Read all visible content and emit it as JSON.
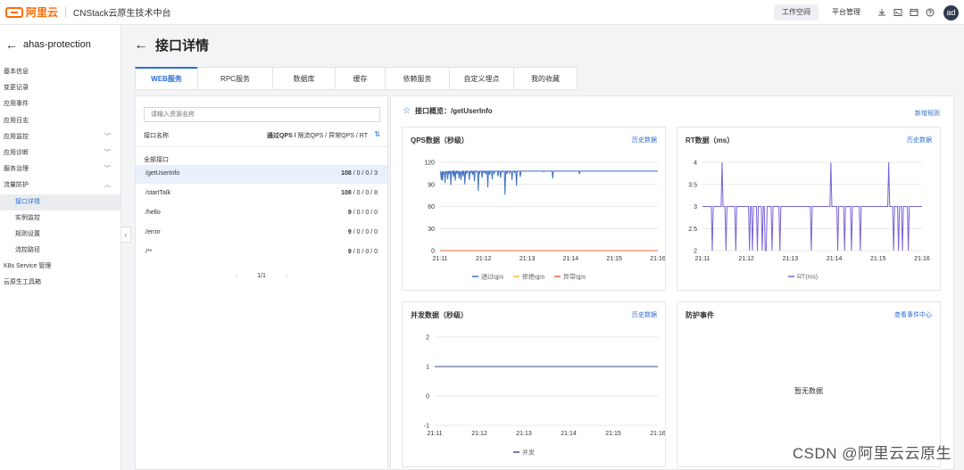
{
  "topbar": {
    "logo_text": "阿里云",
    "product_name": "CNStack云原生技术中台",
    "tabs": [
      "工作空间",
      "平台管理"
    ],
    "avatar": "ad"
  },
  "sidebar": {
    "back_icon": "arrow-left-icon",
    "app_name": "ahas-protection",
    "items": [
      {
        "label": "基本信息",
        "level": 1
      },
      {
        "label": "变更记录",
        "level": 1
      },
      {
        "label": "应用事件",
        "level": 1
      },
      {
        "label": "应用日志",
        "level": 1
      },
      {
        "label": "应用监控",
        "level": 1,
        "chevron": "down"
      },
      {
        "label": "应用诊断",
        "level": 1,
        "chevron": "down"
      },
      {
        "label": "服务治理",
        "level": 1,
        "chevron": "down"
      },
      {
        "label": "流量防护",
        "level": 1,
        "chevron": "up"
      },
      {
        "label": "接口详情",
        "level": 2,
        "active": true
      },
      {
        "label": "实例监控",
        "level": 2
      },
      {
        "label": "规则设置",
        "level": 2
      },
      {
        "label": "流控路径",
        "level": 2
      },
      {
        "label": "K8s Service 管理",
        "level": 1
      },
      {
        "label": "云原生工具箱",
        "level": 1
      }
    ]
  },
  "page": {
    "title": "接口详情",
    "tabs": [
      "WEB服务",
      "RPC服务",
      "数据库",
      "缓存",
      "依赖服务",
      "自定义埋点",
      "我的收藏"
    ],
    "active_tab": 0
  },
  "api_list": {
    "search_placeholder": "请输入资源名称",
    "header_name": "接口名称",
    "header_cols_bold": "通过QPS /",
    "header_cols_rest": " 限流QPS / 异常QPS / RT",
    "all_label": "全部接口",
    "rows": [
      {
        "name": "/getUserInfo",
        "pass": "108",
        "rest": " / 0 / 0 / 3",
        "selected": true
      },
      {
        "name": "/startTalk",
        "pass": "108",
        "rest": " / 0 / 0 / 8"
      },
      {
        "name": "/hello",
        "pass": "9",
        "rest": " / 0 / 0 / 0"
      },
      {
        "name": "/error",
        "pass": "9",
        "rest": " / 0 / 0 / 0"
      },
      {
        "name": "/**",
        "pass": "9",
        "rest": " / 0 / 0 / 0"
      }
    ],
    "pager": "1/1"
  },
  "overview": {
    "title": "接口概览：/getUserInfo",
    "new_rule": "新增规则",
    "history_link": "历史数据",
    "events_title": "防护事件",
    "events_link": "查看事件中心",
    "events_empty": "暂无数据"
  },
  "chart_data": [
    {
      "type": "line",
      "title": "QPS数据（秒级）",
      "x": [
        "21:11",
        "21:12",
        "21:13",
        "21:14",
        "21:15",
        "21:16"
      ],
      "ylim": [
        0,
        120
      ],
      "yticks": [
        0,
        30,
        60,
        90,
        120
      ],
      "series": [
        {
          "name": "通过qps",
          "color": "#3b6ec2",
          "values": [
            108,
            106,
            96,
            108,
            95,
            108,
            104,
            107,
            92,
            108,
            106,
            108,
            97,
            108,
            105,
            108,
            108,
            89,
            108,
            106,
            108,
            100,
            108,
            107,
            95,
            108,
            108,
            104,
            108,
            108,
            98,
            108,
            106,
            96,
            108,
            108,
            101,
            108,
            107,
            90,
            108,
            108,
            105,
            108,
            108,
            108,
            96,
            108,
            106,
            108,
            108,
            103,
            108,
            108,
            94,
            108,
            108,
            107,
            108,
            108,
            81,
            108,
            105,
            108,
            108,
            108,
            99,
            108,
            108,
            106,
            108,
            108,
            104,
            108,
            108,
            86,
            108,
            108,
            103,
            108,
            108,
            108,
            97,
            108,
            108,
            105,
            108,
            108,
            108,
            108,
            108,
            101,
            108,
            108,
            108,
            99,
            108,
            108,
            107,
            108,
            108,
            108,
            76,
            108,
            108,
            104,
            108,
            108,
            108,
            105,
            108,
            108,
            108,
            96,
            108,
            108,
            108,
            106,
            108,
            108,
            88,
            108,
            108,
            108,
            108,
            108,
            100,
            108,
            108,
            108,
            108,
            108,
            108,
            108,
            108,
            108,
            108,
            108,
            108,
            108,
            108,
            108,
            108,
            108,
            108,
            108,
            108,
            108,
            108,
            108,
            108,
            108,
            108,
            108,
            108,
            108,
            108,
            108,
            108,
            108,
            108,
            108,
            108,
            107,
            108,
            108,
            108,
            108,
            108,
            108,
            108,
            108,
            108,
            108,
            108,
            108,
            108,
            98,
            108,
            108,
            108,
            108,
            108,
            108,
            108,
            108,
            108,
            108,
            108,
            108,
            108,
            108,
            108,
            108,
            108,
            108,
            108,
            108,
            108,
            108,
            108,
            108,
            108,
            108,
            108,
            108,
            108,
            108,
            108,
            108,
            108,
            108,
            108,
            108,
            108,
            108,
            108,
            108,
            108,
            104,
            108,
            108,
            108,
            108,
            108,
            108,
            108,
            108,
            108,
            108,
            108,
            108,
            108,
            108,
            108,
            108,
            108,
            108,
            108,
            108,
            108,
            108,
            108,
            108,
            108,
            108,
            108,
            108,
            108,
            108,
            108,
            108,
            108,
            108,
            108,
            108,
            108,
            108,
            108,
            108,
            108,
            108,
            108,
            108,
            108,
            108,
            108,
            108,
            108,
            108,
            108,
            108,
            108,
            108,
            108,
            108,
            108,
            108,
            108,
            108,
            108,
            108,
            108,
            108,
            108,
            108,
            108,
            108,
            108,
            108,
            108,
            108,
            108,
            108,
            108,
            108,
            108,
            108,
            108,
            108,
            108,
            108,
            108,
            108,
            108,
            108,
            108,
            108,
            108,
            108,
            108,
            108,
            108,
            108,
            108,
            108,
            108,
            108,
            108,
            108,
            108,
            108,
            108,
            108,
            108,
            108,
            108,
            108,
            108,
            108,
            108,
            108,
            108,
            108,
            108,
            108,
            108,
            108,
            108,
            108,
            108,
            108,
            108
          ]
        },
        {
          "name": "拒绝qps",
          "color": "#f2b93b",
          "values": [
            0,
            0
          ]
        },
        {
          "name": "异常qps",
          "color": "#e8663c",
          "values": [
            0,
            0
          ]
        }
      ]
    },
    {
      "type": "line",
      "title": "RT数据（ms）",
      "x": [
        "21:11",
        "21:12",
        "21:13",
        "21:14",
        "21:15",
        "21:16"
      ],
      "ylim": [
        2,
        4
      ],
      "yticks": [
        2,
        2.5,
        3,
        3.5,
        4
      ],
      "series": [
        {
          "name": "RT(ms)",
          "color": "#7a62d6",
          "values": [
            3,
            3,
            3,
            3,
            3,
            3,
            3,
            3,
            3,
            3,
            2,
            3,
            3,
            3,
            3,
            3,
            3,
            3,
            3,
            3,
            4,
            3,
            3,
            3,
            2,
            3,
            3,
            3,
            3,
            3,
            3,
            3,
            3,
            3,
            2,
            3,
            3,
            3,
            3,
            3,
            3,
            3,
            3,
            3,
            3,
            3,
            3,
            3,
            2,
            3,
            3,
            2,
            3,
            3,
            3,
            3,
            2,
            3,
            3,
            3,
            3,
            2,
            3,
            3,
            2,
            2,
            3,
            3,
            3,
            3,
            3,
            2,
            3,
            3,
            3,
            3,
            3,
            3,
            3,
            2,
            3,
            3,
            3,
            3,
            3,
            3,
            3,
            3,
            3,
            3,
            3,
            3,
            3,
            3,
            3,
            3,
            3,
            3,
            3,
            3,
            3,
            3,
            3,
            3,
            3,
            3,
            3,
            3,
            3,
            3,
            3,
            2,
            3,
            3,
            3,
            3,
            3,
            3,
            3,
            3,
            3,
            3,
            3,
            3,
            3,
            3,
            3,
            3,
            3,
            3,
            3,
            4,
            3,
            3,
            3,
            3,
            3,
            3,
            2,
            3,
            3,
            3,
            3,
            3,
            3,
            2,
            3,
            3,
            3,
            3,
            3,
            3,
            2,
            3,
            3,
            3,
            3,
            3,
            3,
            3,
            3,
            2,
            3,
            3,
            3,
            3,
            3,
            3,
            3,
            3,
            3,
            3,
            3,
            3,
            3,
            3,
            3,
            3,
            3,
            3,
            3,
            3,
            3,
            3,
            3,
            3,
            3,
            3,
            3,
            3,
            4,
            3,
            3,
            3,
            3,
            2,
            3,
            3,
            3,
            3,
            2,
            3,
            3,
            3,
            2,
            3,
            3,
            3,
            3,
            3,
            2,
            3,
            3,
            3,
            3,
            3,
            3,
            3,
            3,
            3,
            3,
            3,
            3,
            3,
            3
          ]
        }
      ]
    },
    {
      "type": "line",
      "title": "并发数据（秒级）",
      "x": [
        "21:11",
        "21:12",
        "21:13",
        "21:14",
        "21:15",
        "21:16"
      ],
      "ylim": [
        -1,
        2
      ],
      "yticks": [
        -1,
        0,
        1,
        2
      ],
      "series": [
        {
          "name": "并发",
          "color": "#3b4f8a",
          "values": [
            1,
            1
          ]
        }
      ]
    }
  ],
  "watermark": "CSDN @阿里云云原生"
}
